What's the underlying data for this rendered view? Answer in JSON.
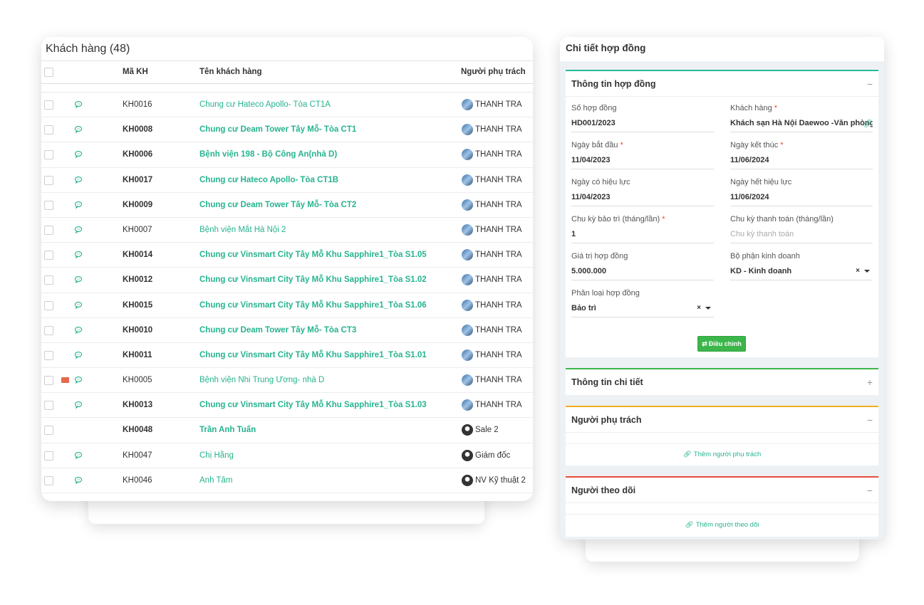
{
  "customers": {
    "title": "Khách hàng (48)",
    "columns": {
      "code": "Mã KH",
      "name": "Tên khách hàng",
      "owner": "Người phụ trách"
    },
    "rows": [
      {
        "code": "KH0016",
        "name": "Chung cư Hateco Apollo- Tòa CT1A",
        "owner": "THANH TRA",
        "bold": false,
        "mail": false,
        "chat": true,
        "avatar": "photo"
      },
      {
        "code": "KH0008",
        "name": "Chung cư Deam Tower Tây Mỗ- Tòa CT1",
        "owner": "THANH TRA",
        "bold": true,
        "mail": false,
        "chat": true,
        "avatar": "photo"
      },
      {
        "code": "KH0006",
        "name": "Bệnh viện 198 - Bộ Công An(nhà D)",
        "owner": "THANH TRA",
        "bold": true,
        "mail": false,
        "chat": true,
        "avatar": "photo"
      },
      {
        "code": "KH0017",
        "name": "Chung cư Hateco Apollo- Tòa CT1B",
        "owner": "THANH TRA",
        "bold": true,
        "mail": false,
        "chat": true,
        "avatar": "photo"
      },
      {
        "code": "KH0009",
        "name": "Chung cư Deam Tower Tây Mỗ- Tòa CT2",
        "owner": "THANH TRA",
        "bold": true,
        "mail": false,
        "chat": true,
        "avatar": "photo"
      },
      {
        "code": "KH0007",
        "name": "Bệnh viện Mắt Hà Nội 2",
        "owner": "THANH TRA",
        "bold": false,
        "mail": false,
        "chat": true,
        "avatar": "photo"
      },
      {
        "code": "KH0014",
        "name": "Chung cư Vinsmart City Tây Mỗ Khu Sapphire1_Tòa S1.05",
        "owner": "THANH TRA",
        "bold": true,
        "mail": false,
        "chat": true,
        "avatar": "photo"
      },
      {
        "code": "KH0012",
        "name": "Chung cư Vinsmart City Tây Mỗ Khu Sapphire1_Tòa S1.02",
        "owner": "THANH TRA",
        "bold": true,
        "mail": false,
        "chat": true,
        "avatar": "photo"
      },
      {
        "code": "KH0015",
        "name": "Chung cư Vinsmart City Tây Mỗ Khu Sapphire1_Tòa S1.06",
        "owner": "THANH TRA",
        "bold": true,
        "mail": false,
        "chat": true,
        "avatar": "photo"
      },
      {
        "code": "KH0010",
        "name": "Chung cư Deam Tower Tây Mỗ- Tòa CT3",
        "owner": "THANH TRA",
        "bold": true,
        "mail": false,
        "chat": true,
        "avatar": "photo"
      },
      {
        "code": "KH0011",
        "name": "Chung cư Vinsmart City Tây Mỗ Khu Sapphire1_Tòa S1.01",
        "owner": "THANH TRA",
        "bold": true,
        "mail": false,
        "chat": true,
        "avatar": "photo"
      },
      {
        "code": "KH0005",
        "name": "Bệnh viện Nhi Trung Ương- nhà D",
        "owner": "THANH TRA",
        "bold": false,
        "mail": true,
        "chat": true,
        "avatar": "photo"
      },
      {
        "code": "KH0013",
        "name": "Chung cư Vinsmart City Tây Mỗ Khu Sapphire1_Tòa S1.03",
        "owner": "THANH TRA",
        "bold": true,
        "mail": false,
        "chat": true,
        "avatar": "photo"
      },
      {
        "code": "KH0048",
        "name": "Trần Anh Tuấn",
        "owner": "Sale 2",
        "bold": true,
        "mail": false,
        "chat": false,
        "avatar": "user"
      },
      {
        "code": "KH0047",
        "name": "Chị Hằng",
        "owner": "Giám đốc",
        "bold": false,
        "mail": false,
        "chat": true,
        "avatar": "user"
      },
      {
        "code": "KH0046",
        "name": "Anh Tâm",
        "owner": "NV Kỹ thuật 2",
        "bold": false,
        "mail": false,
        "chat": true,
        "avatar": "user"
      }
    ]
  },
  "contract": {
    "title": "Chi tiết hợp đồng",
    "info_section": {
      "title": "Thông tin hợp đồng",
      "toggle": "−",
      "fields": {
        "number": {
          "label": "Số hợp đồng",
          "value": "HD001/2023"
        },
        "customer": {
          "label": "Khách hàng",
          "required": "*",
          "value": "Khách sạn Hà Nội Daewoo -Văn phòng"
        },
        "start_date": {
          "label": "Ngày bắt đầu",
          "required": "*",
          "value": "11/04/2023"
        },
        "end_date": {
          "label": "Ngày kết thúc",
          "required": "*",
          "value": "11/06/2024"
        },
        "effective_date": {
          "label": "Ngày có hiệu lực",
          "value": "11/04/2023"
        },
        "expiry_date": {
          "label": "Ngày hết hiệu lực",
          "value": "11/06/2024"
        },
        "maintenance_cycle": {
          "label": "Chu kỳ bảo trì (tháng/lần)",
          "required": "*",
          "value": "1"
        },
        "payment_cycle": {
          "label": "Chu kỳ thanh toán (tháng/lần)",
          "placeholder": "Chu kỳ thanh toán"
        },
        "value": {
          "label": "Giá trị hợp đồng",
          "value": "5.000.000"
        },
        "department": {
          "label": "Bộ phận kinh doanh",
          "value": "KD - Kinh doanh",
          "clear": "×"
        },
        "type": {
          "label": "Phân loại hợp đồng",
          "value": "Bảo trì",
          "clear": "×"
        }
      },
      "adjust_button": "Điều chỉnh"
    },
    "detail_section": {
      "title": "Thông tin chi tiết",
      "toggle": "+"
    },
    "owner_section": {
      "title": "Người phụ trách",
      "toggle": "−",
      "add_link": "Thêm người phụ trách"
    },
    "follower_section": {
      "title": "Người theo dõi",
      "toggle": "−",
      "add_link": "Thêm người theo dõi"
    },
    "colors": {
      "green": "#26b99a",
      "lime": "#3cb64a",
      "orange": "#f0ad1e",
      "red": "#e74c3c"
    }
  }
}
